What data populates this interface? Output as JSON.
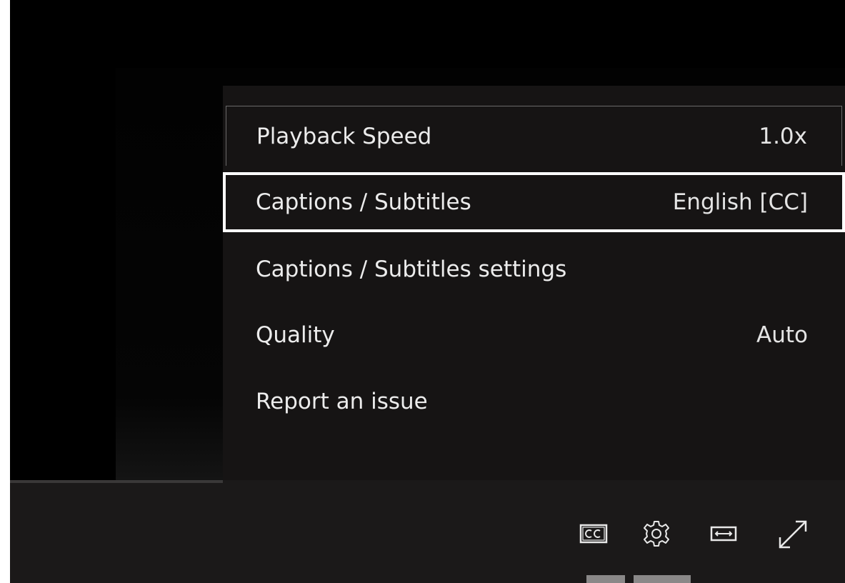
{
  "settings_menu": {
    "items": [
      {
        "label": "Playback Speed",
        "value": "1.0x"
      },
      {
        "label": "Captions / Subtitles",
        "value": "English [CC]"
      },
      {
        "label": "Captions / Subtitles settings",
        "value": ""
      },
      {
        "label": "Quality",
        "value": "Auto"
      },
      {
        "label": "Report an issue",
        "value": ""
      }
    ],
    "focused_item": "Captions / Subtitles"
  },
  "controls": {
    "icons": [
      "closed-captions-icon",
      "gear-icon",
      "widen-icon",
      "fullscreen-icon"
    ]
  },
  "colors": {
    "background": "#000000",
    "menu_background": "#161414",
    "controls_background": "#1b1919",
    "focus_border": "#ffffff",
    "text": "#ececec"
  }
}
